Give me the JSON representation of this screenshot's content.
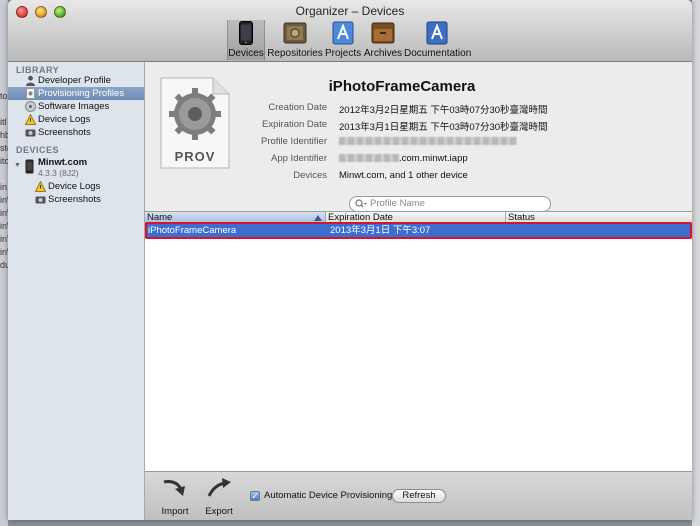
{
  "window": {
    "title": "Organizer – Devices"
  },
  "toolbar": {
    "items": [
      {
        "label": "Devices",
        "icon": "iphone-icon",
        "selected": true
      },
      {
        "label": "Repositories",
        "icon": "repository-icon"
      },
      {
        "label": "Projects",
        "icon": "projects-icon"
      },
      {
        "label": "Archives",
        "icon": "archives-icon"
      },
      {
        "label": "Documentation",
        "icon": "documentation-icon"
      }
    ]
  },
  "sidebar": {
    "library_header": "LIBRARY",
    "library_items": [
      {
        "label": "Developer Profile",
        "icon": "person-icon"
      },
      {
        "label": "Provisioning Profiles",
        "icon": "profile-icon",
        "selected": true
      },
      {
        "label": "Software Images",
        "icon": "disk-image-icon"
      },
      {
        "label": "Device Logs",
        "icon": "log-icon"
      },
      {
        "label": "Screenshots",
        "icon": "camera-icon"
      }
    ],
    "devices_header": "DEVICES",
    "device": {
      "name": "Minwt.com",
      "version": "4.3.3 (8J2)"
    },
    "device_items": [
      {
        "label": "Device Logs",
        "icon": "log-icon"
      },
      {
        "label": "Screenshots",
        "icon": "camera-icon"
      }
    ]
  },
  "detail": {
    "icon_text": "PROV",
    "title": "iPhotoFrameCamera",
    "fields": [
      {
        "label": "Creation Date",
        "value": "2012年3月2日星期五 下午03時07分30秒臺灣時間"
      },
      {
        "label": "Expiration Date",
        "value": "2013年3月1日星期五 下午03時07分30秒臺灣時間"
      },
      {
        "label": "Profile Identifier",
        "value": ""
      },
      {
        "label": "App Identifier",
        "value": ".com.minwt.iapp"
      },
      {
        "label": "Devices",
        "value": "Minwt.com, and 1 other device"
      }
    ]
  },
  "search": {
    "placeholder": "Profile Name"
  },
  "table": {
    "columns": [
      "Name",
      "Expiration Date",
      "Status"
    ],
    "rows": [
      {
        "name": "iPhotoFrameCamera",
        "expiration": "2013年3月1日 下午3:07",
        "status": ""
      }
    ]
  },
  "bottom": {
    "import_label": "Import",
    "export_label": "Export",
    "auto_provisioning_label": "Automatic Device Provisioning",
    "auto_provisioning_checked": true,
    "refresh_label": "Refresh"
  },
  "background_items": [
    "",
    "to",
    "",
    "itl",
    "hb",
    "sto",
    "ito",
    "",
    "in",
    "in\\",
    "in\\",
    "in\\",
    "inV",
    "in\\",
    "du"
  ],
  "colors": {
    "selection": "#3d6ecf",
    "highlight_box": "#d8142c",
    "sidebar_bg": "#dde4ec"
  }
}
